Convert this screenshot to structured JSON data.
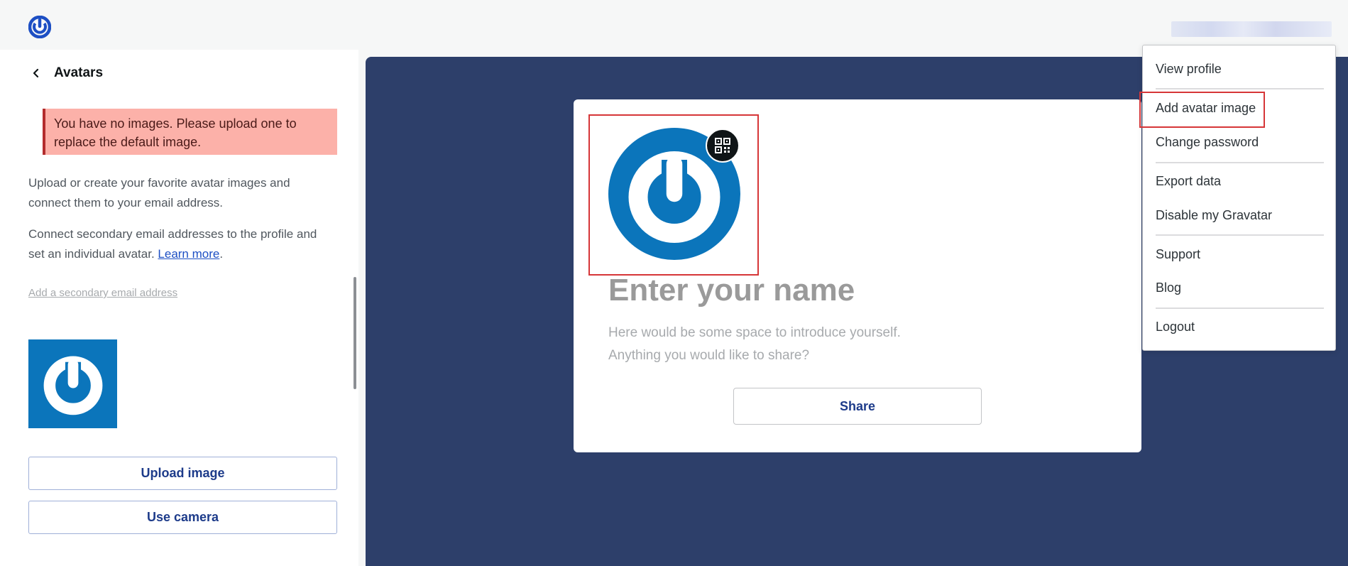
{
  "header": {
    "logo_icon": "gravatar-logo-icon",
    "user_name_blurred": true
  },
  "sidebar": {
    "back_icon": "chevron-left-icon",
    "title": "Avatars",
    "notice": "You have no images. Please upload one to replace the default image.",
    "description_1": "Upload or create your favorite avatar images and connect them to your email address.",
    "description_2_prefix": "Connect secondary email addresses to the profile and set an individual avatar.",
    "learn_more_label": "Learn more",
    "description_2_suffix": ".",
    "add_secondary_email_label": "Add a secondary email address",
    "upload_button_label": "Upload image",
    "camera_button_label": "Use camera"
  },
  "preview": {
    "qr_icon": "qr-code-icon",
    "name_placeholder": "Enter your name",
    "intro_line_1": "Here would be some space to introduce yourself.",
    "intro_line_2": "Anything you would like to share?",
    "share_button_label": "Share"
  },
  "user_menu": {
    "items": [
      {
        "label": "View profile"
      },
      {
        "label": "Add avatar image",
        "highlighted": true
      },
      {
        "label": "Change password"
      },
      {
        "label": "Export data"
      },
      {
        "label": "Disable my Gravatar"
      },
      {
        "label": "Support"
      },
      {
        "label": "Blog"
      },
      {
        "label": "Logout"
      }
    ]
  },
  "colors": {
    "brand_blue": "#0b75bb",
    "preview_background": "#2d3f6a",
    "notice_background": "#fcb1a9",
    "highlight_red": "#d63638",
    "link_blue": "#1d4fc4"
  }
}
